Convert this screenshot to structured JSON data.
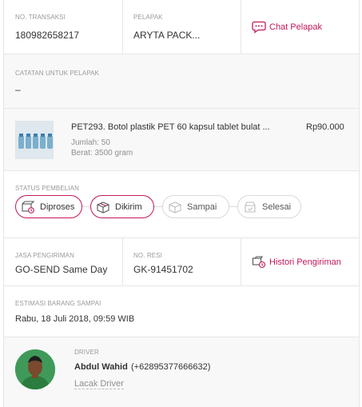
{
  "transaction": {
    "id_label": "NO. TRANSAKSI",
    "id_value": "180982658217",
    "seller_label": "PELAPAK",
    "seller_value": "ARYTA PACK...",
    "chat_label": "Chat Pelapak"
  },
  "notes": {
    "label": "CATATAN UNTUK PELAPAK",
    "value": "–"
  },
  "product": {
    "name": "PET293. Botol plastik PET 60 kapsul tablet bulat ...",
    "price": "Rp90.000",
    "quantity": "Jumlah: 50",
    "weight": "Berat: 3500 gram"
  },
  "status": {
    "label": "STATUS PEMBELIAN",
    "steps": [
      {
        "label": "Diproses",
        "active": true,
        "icon": "box-process-icon"
      },
      {
        "label": "Dikirim",
        "active": true,
        "icon": "box-ship-icon"
      },
      {
        "label": "Sampai",
        "active": false,
        "icon": "box-arrive-icon"
      },
      {
        "label": "Selesai",
        "active": false,
        "icon": "box-done-icon"
      }
    ]
  },
  "shipping": {
    "service_label": "JASA PENGIRIMAN",
    "service_value": "GO-SEND Same Day",
    "resi_label": "NO. RESI",
    "resi_value": "GK-91451702",
    "history_label": "Histori Pengiriman"
  },
  "estimate": {
    "label": "ESTIMASI BARANG SAMPAI",
    "value": "Rabu, 18 Juli 2018, 09:59 WIB"
  },
  "driver": {
    "label": "DRIVER",
    "name": "Abdul Wahid",
    "phone": "(+62895377666632)",
    "track_label": "Lacak Driver"
  },
  "colors": {
    "accent": "#c2185b",
    "border": "#e6e6e6",
    "muted": "#9a9a9a"
  }
}
